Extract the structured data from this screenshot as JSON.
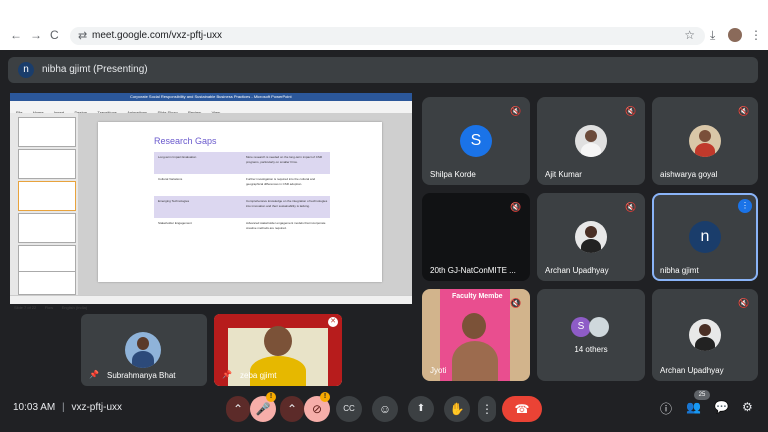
{
  "browser": {
    "url": "meet.google.com/vxz-pftj-uxx",
    "back_glyph": "←",
    "forward_glyph": "→",
    "reload_glyph": "C",
    "site_glyph": "⇄",
    "star_glyph": "☆",
    "download_glyph": "⤓",
    "menu_glyph": "⋮"
  },
  "presenting": {
    "avatar_letter": "n",
    "label": "nibha gjimt (Presenting)"
  },
  "slide": {
    "title_bar": "Corporate Social Responsibility and Sustainable Business Practices - Microsoft PowerPoint",
    "ribbon_tabs": [
      "File",
      "Home",
      "Insert",
      "Design",
      "Transitions",
      "Animations",
      "Slide Show",
      "Review",
      "View"
    ],
    "heading": "Research Gaps",
    "rows": [
      {
        "left": "Long-term Impact Evaluation",
        "right": "More research is needed on the long-term impact of CSR programs, particularly on smaller firms."
      },
      {
        "left": "Cultural Variations",
        "right": "Further investigation is required into the cultural and geographical differences in CSR adoption."
      },
      {
        "left": "Emerging Technologies",
        "right": "Comprehensive knowledge on the integration of technologies into innovation and their sustainability is lacking."
      },
      {
        "left": "Stakeholder Engagement",
        "right": "Advanced stakeholder engagement models that incorporate creative methods are required."
      }
    ],
    "status": [
      "Slide 7 of 22",
      "Flow",
      "English (India)"
    ]
  },
  "tiles": [
    {
      "name": "Shilpa Korde",
      "letter": "S",
      "color": "#1a73e8"
    },
    {
      "name": "Ajit Kumar"
    },
    {
      "name": "aishwarya goyal"
    },
    {
      "name": "20th GJ-NatConMITE ..."
    },
    {
      "name": "Archan Upadhyay"
    },
    {
      "name": "nibha gjimt",
      "letter": "n",
      "color": "#1a3d6b"
    },
    {
      "name": "Jyoti",
      "tag": "Faculty Membe"
    },
    {
      "name": "14 others",
      "letter": "S"
    },
    {
      "name": "Archan Upadhyay"
    }
  ],
  "self_tiles": [
    {
      "name": "Subrahmanya Bhat"
    },
    {
      "name": "zeba gjimt"
    }
  ],
  "footer": {
    "time": "10:03 AM",
    "separator": "|",
    "code": "vxz-pftj-uxx",
    "participants_count": "25",
    "warn_glyph": "!",
    "chevron_glyph": "⌃",
    "mic_glyph": "🎤",
    "cam_glyph": "⊘",
    "cc_glyph": "CC",
    "emoji_glyph": "☺",
    "present_glyph": "⬆",
    "hand_glyph": "✋",
    "more_glyph": "⋮",
    "hangup_glyph": "☎",
    "info_glyph": "ⓘ",
    "people_glyph": "👥",
    "chat_glyph": "💬",
    "activities_glyph": "⚙"
  },
  "colors": {
    "background": "#202124",
    "tile": "#3c4043",
    "hangup": "#ea4335",
    "accent_active": "#8ab4f8",
    "slide_heading": "#6a5acd"
  }
}
